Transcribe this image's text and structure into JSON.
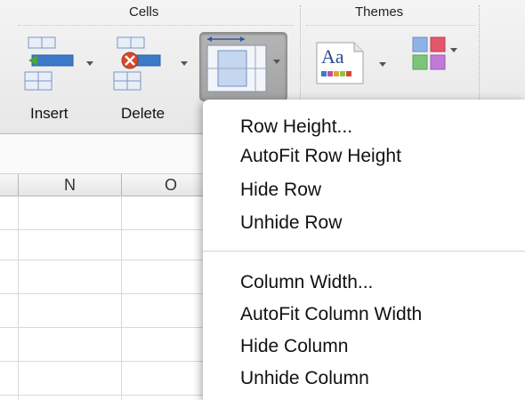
{
  "ribbon": {
    "cells_group_title": "Cells",
    "themes_group_title": "Themes",
    "insert_label": "Insert",
    "delete_label": "Delete",
    "themes_sample_text": "Aa"
  },
  "grid": {
    "columns": [
      "N",
      "O"
    ]
  },
  "format_menu": {
    "row_items": [
      "Row Height...",
      "AutoFit Row Height",
      "Hide Row",
      "Unhide Row"
    ],
    "column_items": [
      "Column Width...",
      "AutoFit Column Width",
      "Hide Column",
      "Unhide Column"
    ]
  },
  "colors": {
    "accent_blue": "#3b79c9",
    "delete_red": "#d9472b",
    "insert_green": "#4aa63c"
  }
}
